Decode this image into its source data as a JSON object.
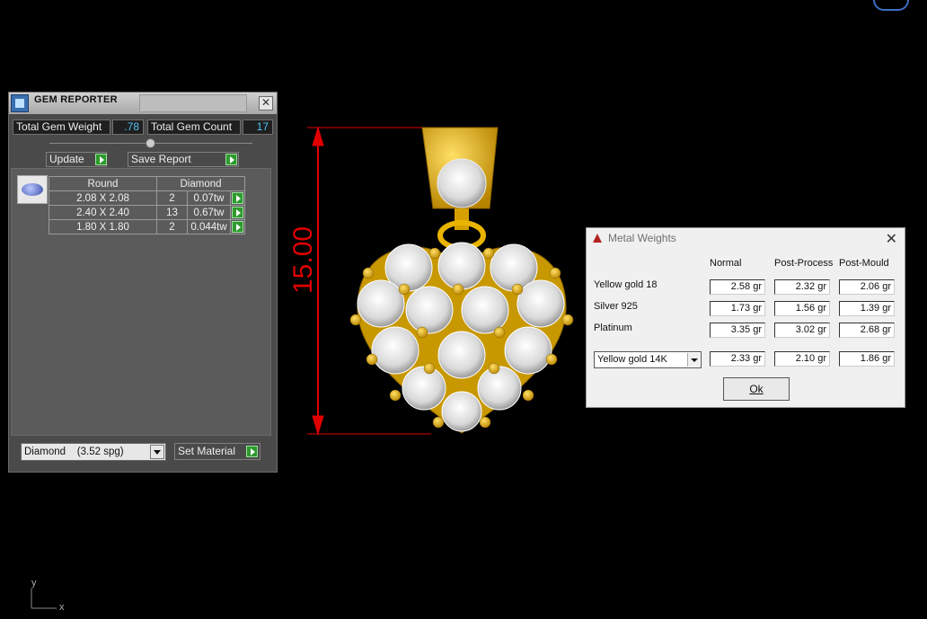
{
  "gem_reporter": {
    "title": "GEM REPORTER",
    "total_weight_label": "Total Gem Weight",
    "total_weight_value": ".78",
    "total_count_label": "Total Gem Count",
    "total_count_value": "17",
    "update_label": "Update",
    "save_report_label": "Save Report",
    "table_headers": [
      "Round",
      "Diamond"
    ],
    "rows": [
      {
        "size": "2.08 X 2.08",
        "count": "2",
        "weight": "0.07tw"
      },
      {
        "size": "2.40 X 2.40",
        "count": "13",
        "weight": "0.67tw"
      },
      {
        "size": "1.80 X 1.80",
        "count": "2",
        "weight": "0.044tw"
      }
    ],
    "material_value": "Diamond    (3.52 spg)",
    "set_material_label": "Set Material"
  },
  "dimension_label": "15.00",
  "metal_weights": {
    "title": "Metal Weights",
    "columns": [
      "Normal",
      "Post-Process",
      "Post-Mould"
    ],
    "rows": [
      {
        "metal": "Yellow gold 18",
        "normal": "2.58 gr",
        "post_process": "2.32 gr",
        "post_mould": "2.06 gr"
      },
      {
        "metal": "Silver 925",
        "normal": "1.73 gr",
        "post_process": "1.56 gr",
        "post_mould": "1.39 gr"
      },
      {
        "metal": "Platinum",
        "normal": "3.35 gr",
        "post_process": "3.02 gr",
        "post_mould": "2.68 gr"
      }
    ],
    "custom_metal": "Yellow gold 14K",
    "custom_values": {
      "normal": "2.33 gr",
      "post_process": "2.10 gr",
      "post_mould": "1.86 gr"
    },
    "ok_label": "Ok"
  },
  "axis": {
    "y": "y",
    "x": "x"
  },
  "colors": {
    "gold": "#e8b400",
    "dimension": "#e10000",
    "accent_value": "#4fc3f7"
  }
}
